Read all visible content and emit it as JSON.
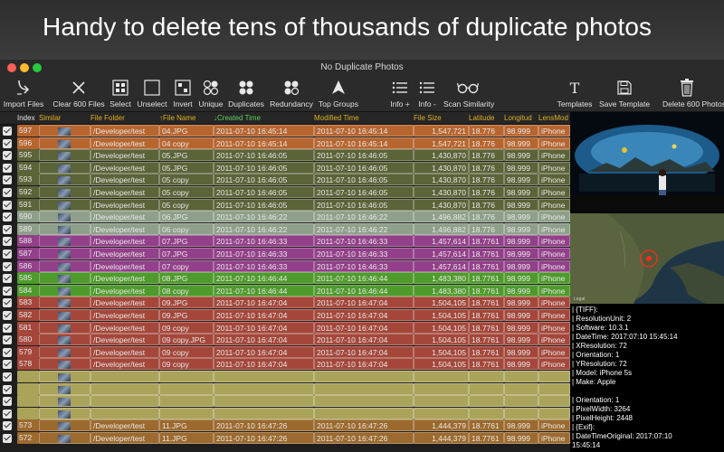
{
  "banner": {
    "text": "Handy to delete tens of thousands of duplicate photos"
  },
  "window": {
    "title": "No Duplicate Photos"
  },
  "toolbar": {
    "import": "Import Files",
    "clear": "Clear 600 Files",
    "select": "Select",
    "unselect": "Unselect",
    "invert": "Invert",
    "unique": "Unique",
    "duplicates": "Duplicates",
    "redundancy": "Redundancy",
    "top_groups": "Top Groups",
    "info_plus": "Info +",
    "info_minus": "Info -",
    "scan_similarity": "Scan Similarity",
    "templates": "Templates",
    "save_template": "Save Template",
    "delete": "Delete 600 Photos"
  },
  "columns": [
    {
      "key": "index",
      "label": "Index",
      "color": "#e8e8e8"
    },
    {
      "key": "similar",
      "label": "Similar",
      "color": "#e0b020"
    },
    {
      "key": "folder",
      "label": "File Folder",
      "color": "#e0b020"
    },
    {
      "key": "name",
      "label": "↑File Name",
      "color": "#e0b020"
    },
    {
      "key": "created",
      "label": "↓Created Time",
      "color": "#5ad05a"
    },
    {
      "key": "modified",
      "label": "Modified Time",
      "color": "#e0b020"
    },
    {
      "key": "size",
      "label": "File Size",
      "color": "#e0b020"
    },
    {
      "key": "lat",
      "label": "Latitude",
      "color": "#e0b020"
    },
    {
      "key": "lon",
      "label": "Longitud",
      "color": "#e0b020"
    },
    {
      "key": "lens",
      "label": "LensMod",
      "color": "#e0b020"
    }
  ],
  "rows": [
    {
      "index": "597",
      "folder": "/Developer/test",
      "name": "04.JPG",
      "created": "2011-07-10 16:45:14",
      "modified": "2011-07-10 16:45:14",
      "size": "1,547,721",
      "lat": "18.776",
      "lon": "98.999",
      "lens": "iPhone",
      "color": "#b7652f"
    },
    {
      "index": "596",
      "folder": "/Developer/test",
      "name": "04 copy",
      "created": "2011-07-10 16:45:14",
      "modified": "2011-07-10 16:45:14",
      "size": "1,547,721",
      "lat": "18.776",
      "lon": "98.999",
      "lens": "iPhone",
      "color": "#b7652f"
    },
    {
      "index": "595",
      "folder": "/Developer/test",
      "name": "05.JPG",
      "created": "2011-07-10 16:46:05",
      "modified": "2011-07-10 16:46:05",
      "size": "1,430,870",
      "lat": "18.776",
      "lon": "98.999",
      "lens": "iPhone",
      "color": "#5b6338"
    },
    {
      "index": "594",
      "folder": "/Developer/test",
      "name": "05.JPG",
      "created": "2011-07-10 16:46:05",
      "modified": "2011-07-10 16:46:05",
      "size": "1,430,870",
      "lat": "18.776",
      "lon": "98.999",
      "lens": "iPhone",
      "color": "#5b6338"
    },
    {
      "index": "593",
      "folder": "/Developer/test",
      "name": "05 copy",
      "created": "2011-07-10 16:46:05",
      "modified": "2011-07-10 16:46:05",
      "size": "1,430,870",
      "lat": "18.776",
      "lon": "98.999",
      "lens": "iPhone",
      "color": "#5b6338"
    },
    {
      "index": "592",
      "folder": "/Developer/test",
      "name": "05 copy",
      "created": "2011-07-10 16:46:05",
      "modified": "2011-07-10 16:46:05",
      "size": "1,430,870",
      "lat": "18.776",
      "lon": "98.999",
      "lens": "iPhone",
      "color": "#5b6338"
    },
    {
      "index": "591",
      "folder": "/Developer/test",
      "name": "05 copy",
      "created": "2011-07-10 16:46:05",
      "modified": "2011-07-10 16:46:05",
      "size": "1,430,870",
      "lat": "18.776",
      "lon": "98.999",
      "lens": "iPhone",
      "color": "#5b6338"
    },
    {
      "index": "590",
      "folder": "/Developer/test",
      "name": "06.JPG",
      "created": "2011-07-10 16:46:22",
      "modified": "2011-07-10 16:46:22",
      "size": "1,496,882",
      "lat": "18.776",
      "lon": "98.999",
      "lens": "iPhone",
      "color": "#8fa08a"
    },
    {
      "index": "589",
      "folder": "/Developer/test",
      "name": "06 copy",
      "created": "2011-07-10 16:46:22",
      "modified": "2011-07-10 16:46:22",
      "size": "1,496,882",
      "lat": "18.776",
      "lon": "98.999",
      "lens": "iPhone",
      "color": "#8fa08a"
    },
    {
      "index": "588",
      "folder": "/Developer/test",
      "name": "07.JPG",
      "created": "2011-07-10 16:46:33",
      "modified": "2011-07-10 16:46:33",
      "size": "1,457,614",
      "lat": "18.7761",
      "lon": "98.999",
      "lens": "iPhone",
      "color": "#93408a"
    },
    {
      "index": "587",
      "folder": "/Developer/test",
      "name": "07.JPG",
      "created": "2011-07-10 16:46:33",
      "modified": "2011-07-10 16:46:33",
      "size": "1,457,614",
      "lat": "18.7761",
      "lon": "98.999",
      "lens": "iPhone",
      "color": "#93408a"
    },
    {
      "index": "586",
      "folder": "/Developer/test",
      "name": "07 copy",
      "created": "2011-07-10 16:46:33",
      "modified": "2011-07-10 16:46:33",
      "size": "1,457,614",
      "lat": "18.7761",
      "lon": "98.999",
      "lens": "iPhone",
      "color": "#93408a"
    },
    {
      "index": "585",
      "folder": "/Developer/test",
      "name": "08.JPG",
      "created": "2011-07-10 16:46:44",
      "modified": "2011-07-10 16:46:44",
      "size": "1,483,380",
      "lat": "18.7761",
      "lon": "98.999",
      "lens": "iPhone",
      "color": "#4f9a2c"
    },
    {
      "index": "584",
      "folder": "/Developer/test",
      "name": "08 copy",
      "created": "2011-07-10 16:46:44",
      "modified": "2011-07-10 16:46:44",
      "size": "1,483,380",
      "lat": "18.7761",
      "lon": "98.999",
      "lens": "iPhone",
      "color": "#4f9a2c"
    },
    {
      "index": "583",
      "folder": "/Developer/test",
      "name": "09.JPG",
      "created": "2011-07-10 16:47:04",
      "modified": "2011-07-10 16:47:04",
      "size": "1,504,105",
      "lat": "18.7761",
      "lon": "98.999",
      "lens": "iPhone",
      "color": "#a4473a"
    },
    {
      "index": "582",
      "folder": "/Developer/test",
      "name": "09.JPG",
      "created": "2011-07-10 16:47:04",
      "modified": "2011-07-10 16:47:04",
      "size": "1,504,105",
      "lat": "18.7761",
      "lon": "98.999",
      "lens": "iPhone",
      "color": "#a4473a"
    },
    {
      "index": "581",
      "folder": "/Developer/test",
      "name": "09 copy",
      "created": "2011-07-10 16:47:04",
      "modified": "2011-07-10 16:47:04",
      "size": "1,504,105",
      "lat": "18.7761",
      "lon": "98.999",
      "lens": "iPhone",
      "color": "#a4473a"
    },
    {
      "index": "580",
      "folder": "/Developer/test",
      "name": "09 copy.JPG",
      "created": "2011-07-10 16:47:04",
      "modified": "2011-07-10 16:47:04",
      "size": "1,504,105",
      "lat": "18.7761",
      "lon": "98.999",
      "lens": "iPhone",
      "color": "#a4473a"
    },
    {
      "index": "579",
      "folder": "/Developer/test",
      "name": "09 copy",
      "created": "2011-07-10 16:47:04",
      "modified": "2011-07-10 16:47:04",
      "size": "1,504,105",
      "lat": "18.7761",
      "lon": "98.999",
      "lens": "iPhone",
      "color": "#a4473a"
    },
    {
      "index": "578",
      "folder": "/Developer/test",
      "name": "09 copy",
      "created": "2011-07-10 16:47:04",
      "modified": "2011-07-10 16:47:04",
      "size": "1,504,105",
      "lat": "18.7761",
      "lon": "98.999",
      "lens": "iPhone",
      "color": "#a4473a"
    },
    {
      "index": "",
      "folder": "",
      "name": "",
      "created": "",
      "modified": "",
      "size": "",
      "lat": "",
      "lon": "",
      "lens": "",
      "color": "#aaa35a"
    },
    {
      "index": "",
      "folder": "",
      "name": "",
      "created": "",
      "modified": "",
      "size": "",
      "lat": "",
      "lon": "",
      "lens": "",
      "color": "#aaa35a"
    },
    {
      "index": "",
      "folder": "",
      "name": "",
      "created": "",
      "modified": "",
      "size": "",
      "lat": "",
      "lon": "",
      "lens": "",
      "color": "#aaa35a"
    },
    {
      "index": "",
      "folder": "",
      "name": "",
      "created": "",
      "modified": "",
      "size": "",
      "lat": "",
      "lon": "",
      "lens": "",
      "color": "#aaa35a"
    },
    {
      "index": "573",
      "folder": "/Developer/test",
      "name": "11.JPG",
      "created": "2011-07-10 16:47:26",
      "modified": "2011-07-10 16:47:26",
      "size": "1,444,379",
      "lat": "18.7761",
      "lon": "98.999",
      "lens": "iPhone",
      "color": "#9c6a2e"
    },
    {
      "index": "572",
      "folder": "/Developer/test",
      "name": "11.JPG",
      "created": "2011-07-10 16:47:26",
      "modified": "2011-07-10 16:47:26",
      "size": "1,444,379",
      "lat": "18.7761",
      "lon": "98.999",
      "lens": "iPhone",
      "color": "#9c6a2e"
    }
  ],
  "metadata": [
    "| {TIFF}:",
    "  | ResolutionUnit:  2",
    "  | Software:  10.3.1",
    "  | DateTime:  2017:07:10 15:45:14",
    "  | XResolution:  72",
    "  | Orientation:  1",
    "  | YResolution:  72",
    "  | Model:  iPhone 5s",
    "  | Make:  Apple",
    "",
    "| Orientation: 1",
    "| PixelWidth: 3264",
    "| PixelHeight: 2448",
    "| {Exif}:",
    "  | DateTimeOriginal:  2017:07:10",
    "15:45:14"
  ]
}
